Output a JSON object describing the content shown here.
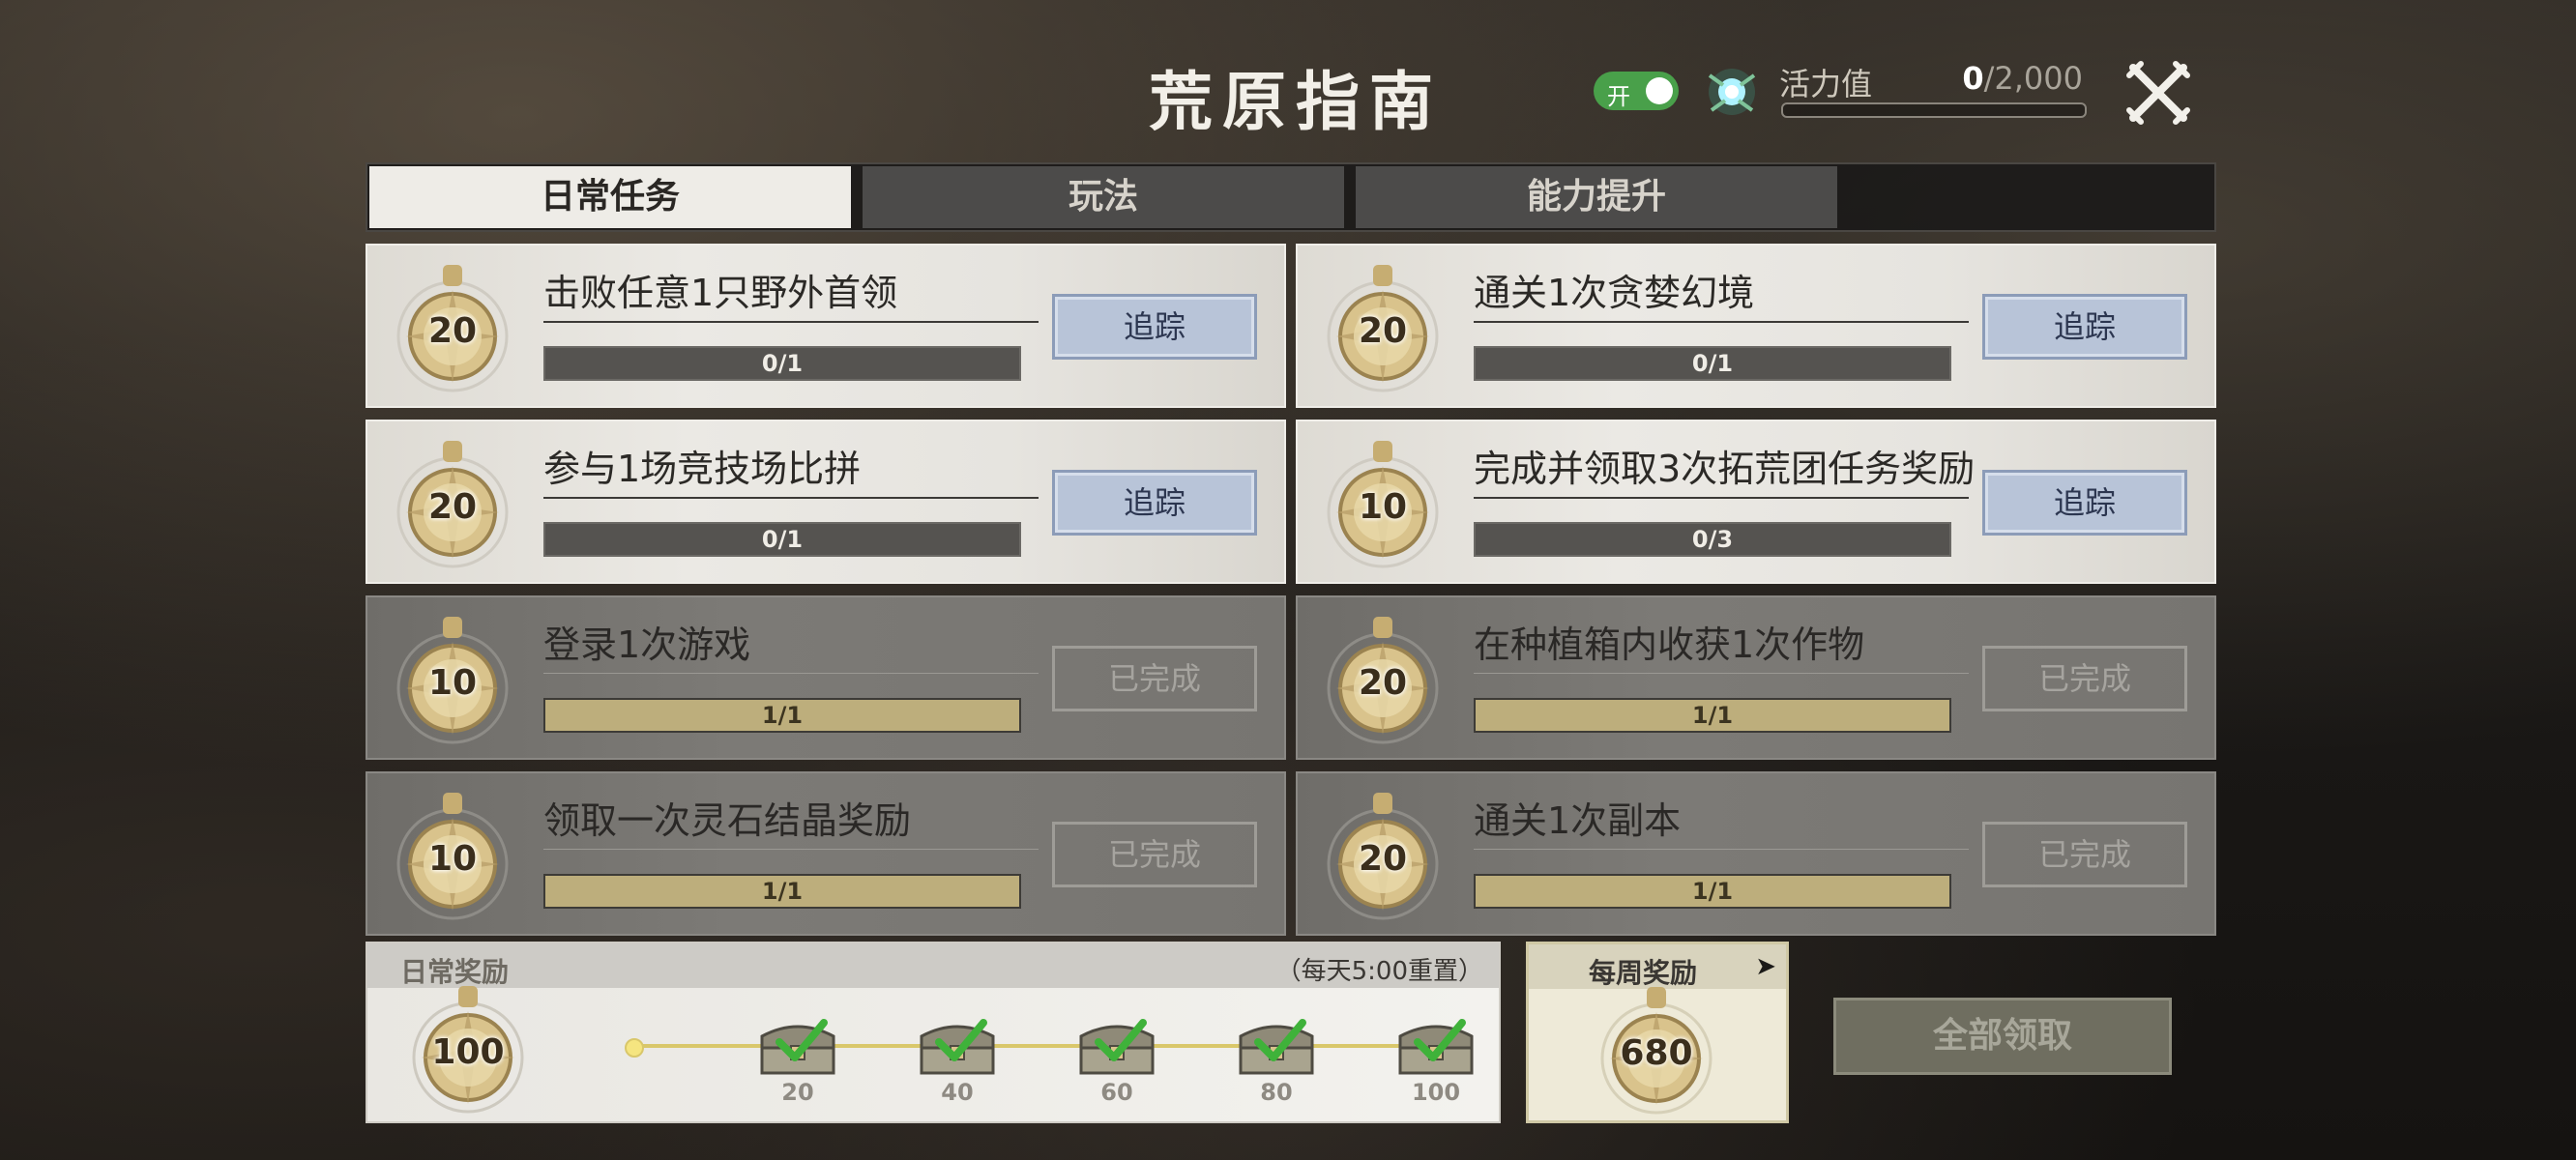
{
  "header": {
    "title": "荒原指南",
    "toggle_label": "开",
    "vitality_label": "活力值",
    "vitality_current": "0",
    "vitality_max": "/2,000"
  },
  "tabs": [
    {
      "label": "日常任务",
      "active": true
    },
    {
      "label": "玩法",
      "active": false
    },
    {
      "label": "能力提升",
      "active": false
    }
  ],
  "tasks": [
    {
      "points": "20",
      "name": "击败任意1只野外首领",
      "progress": "0/1",
      "progress_fraction": 0,
      "button": "追踪",
      "done": false
    },
    {
      "points": "20",
      "name": "通关1次贪婪幻境",
      "progress": "0/1",
      "progress_fraction": 0,
      "button": "追踪",
      "done": false
    },
    {
      "points": "20",
      "name": "参与1场竞技场比拼",
      "progress": "0/1",
      "progress_fraction": 0,
      "button": "追踪",
      "done": false
    },
    {
      "points": "10",
      "name": "完成并领取3次拓荒团任务奖励",
      "progress": "0/3",
      "progress_fraction": 0,
      "button": "追踪",
      "done": false
    },
    {
      "points": "10",
      "name": "登录1次游戏",
      "progress": "1/1",
      "progress_fraction": 1,
      "button": "已完成",
      "done": true
    },
    {
      "points": "20",
      "name": "在种植箱内收获1次作物",
      "progress": "1/1",
      "progress_fraction": 1,
      "button": "已完成",
      "done": true
    },
    {
      "points": "10",
      "name": "领取一次灵石结晶奖励",
      "progress": "1/1",
      "progress_fraction": 1,
      "button": "已完成",
      "done": true
    },
    {
      "points": "20",
      "name": "通关1次副本",
      "progress": "1/1",
      "progress_fraction": 1,
      "button": "已完成",
      "done": true
    }
  ],
  "daily_reward": {
    "title": "日常奖励",
    "reset_note": "（每天5:00重置）",
    "points": "100",
    "milestones": [
      "20",
      "40",
      "60",
      "80",
      "100"
    ]
  },
  "weekly_reward": {
    "title": "每周奖励",
    "arrow": "➤",
    "points": "680"
  },
  "claim_all_label": "全部领取",
  "colors": {
    "toggle_on": "#49a04a",
    "track_button": "#b8c4d8",
    "check_mark": "#3fb23a",
    "medal_gold": "#d9c38c"
  }
}
